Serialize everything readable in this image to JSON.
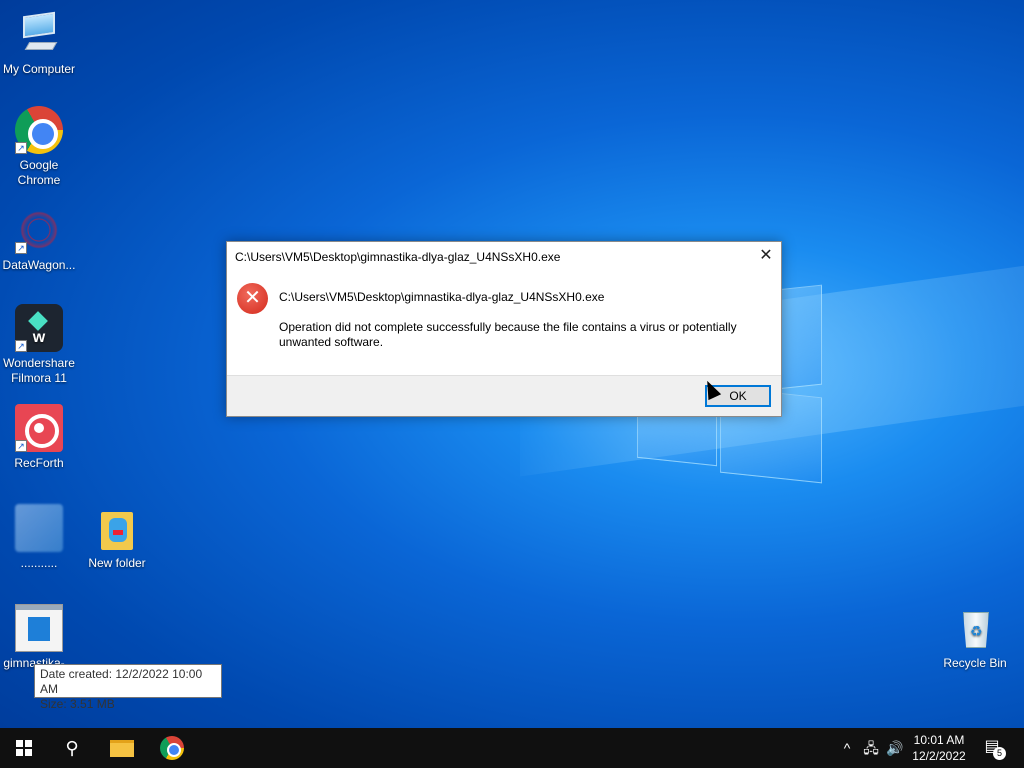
{
  "desktop": {
    "icons": [
      {
        "label": "My Computer",
        "icon": "computer-icon"
      },
      {
        "label": "Google Chrome",
        "icon": "chrome-icon"
      },
      {
        "label": "DataWagon...",
        "icon": "datawagon-icon"
      },
      {
        "label": "Wondershare Filmora 11",
        "icon": "filmora-icon"
      },
      {
        "label": "RecForth",
        "icon": "recforth-icon"
      },
      {
        "label": "...........",
        "icon": "unnamed-icon"
      },
      {
        "label": "New folder",
        "icon": "folder-icon"
      },
      {
        "label": "gimnastika-...",
        "icon": "exe-file-icon"
      },
      {
        "label": "Recycle Bin",
        "icon": "recycle-bin-icon"
      }
    ],
    "tooltip": {
      "date_created": "Date created: 12/2/2022 10:00 AM",
      "size": "Size: 3.51 MB"
    }
  },
  "dialog": {
    "title": "C:\\Users\\VM5\\Desktop\\gimnastika-dlya-glaz_U4NSsXH0.exe",
    "path": "C:\\Users\\VM5\\Desktop\\gimnastika-dlya-glaz_U4NSsXH0.exe",
    "message": "Operation did not complete successfully because the file contains a virus or potentially unwanted software.",
    "ok_label": "OK",
    "close_glyph": "✕",
    "error_glyph": "✕"
  },
  "taskbar": {
    "search_glyph": "⚲",
    "tray_up_glyph": "^",
    "network_glyph": "🖧",
    "volume_glyph": "🔊",
    "time": "10:01 AM",
    "date": "12/2/2022",
    "notification_glyph": "▤",
    "notification_count": "5"
  },
  "colors": {
    "accent": "#0078d7",
    "error": "#d42a1c",
    "taskbar": "#101010"
  }
}
